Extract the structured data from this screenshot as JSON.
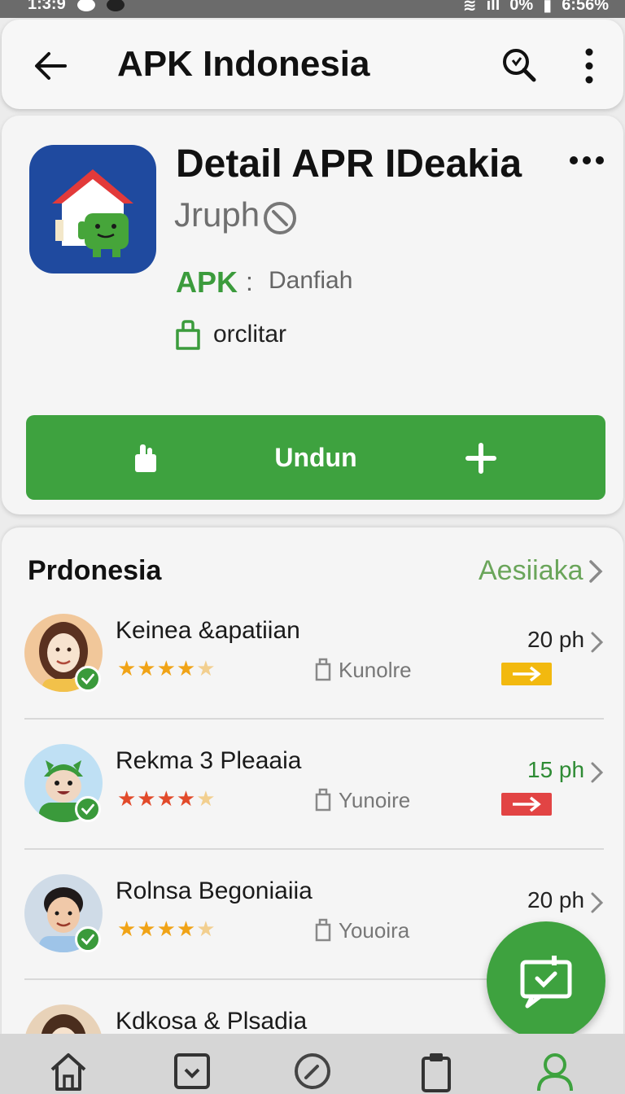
{
  "status_bar": {
    "time": "1:3:9",
    "battery_percent": "0%",
    "battery_right": "6:56%"
  },
  "app_bar": {
    "title": "APK Indonesia",
    "icons": [
      "back-arrow-icon",
      "search-icon",
      "more-vertical-icon"
    ]
  },
  "detail": {
    "title": "Detail APR IDeakia",
    "developer": "Jruph",
    "apk_label": "APK",
    "apk_separator": ":",
    "apk_value": "Danfiah",
    "category": "orclitar",
    "download_button": "Undun"
  },
  "list": {
    "title": "Prdonesia",
    "link": "Aesiiaka",
    "items": [
      {
        "name": "Keinea &apatiian",
        "stars": "★★★★",
        "half_star": "★",
        "tag": "Kunolre",
        "time": "20 ph",
        "flag_color": "#f2b90f",
        "avatar_colors": [
          "#f1c79a",
          "#5a3120",
          "#f7e3cf"
        ]
      },
      {
        "name": "Rekma 3 Pleaaia",
        "stars": "★★★★",
        "half_star": "★",
        "tag": "Yunoire",
        "time": "15 ph",
        "flag_color": "#e24444",
        "avatar_colors": [
          "#bfe0f4",
          "#3a9a3b",
          "#f0d7c2"
        ]
      },
      {
        "name": "Rolnsa Begoniaiia",
        "stars": "★★★★",
        "half_star": "★",
        "tag": "Youoira",
        "time": "20 ph",
        "flag_color": "",
        "avatar_colors": [
          "#cfdbe7",
          "#1f1a1a",
          "#f0c9a9"
        ]
      },
      {
        "name": "Kdkosa & Plsadia",
        "stars": "",
        "half_star": "",
        "tag": "",
        "time": "",
        "flag_color": "",
        "avatar_colors": [
          "#e8d2b8",
          "#4a2d1d",
          "#f6e2cd"
        ]
      }
    ]
  },
  "colors": {
    "accent_green": "#3ea23f",
    "link_green": "#6aa55a",
    "star_orange": "#f0a316",
    "app_icon_blue": "#1f4a9f"
  },
  "bottom_nav": [
    "home-icon",
    "download-icon",
    "compass-icon",
    "clipboard-icon",
    "profile-icon"
  ]
}
